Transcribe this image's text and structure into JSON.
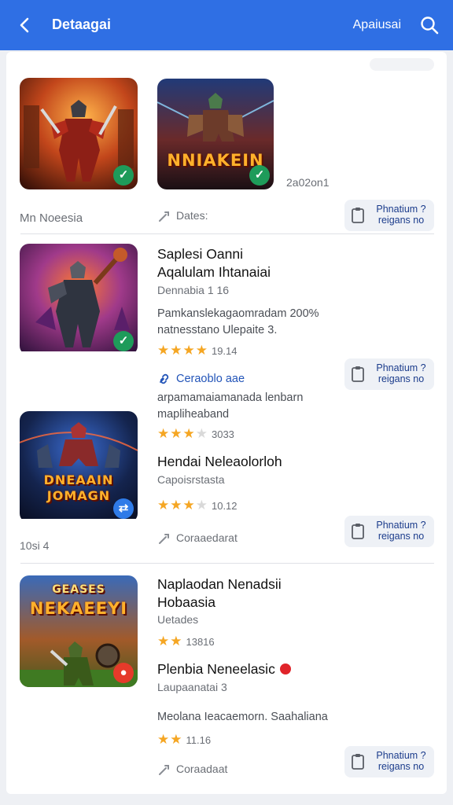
{
  "header": {
    "title": "Detaagai",
    "action": "Apaiusai"
  },
  "top": {
    "thumb_a_text": "",
    "thumb_b_text": "NNIAKEIN",
    "date": "2a02on1",
    "left_label": "Mn Noeesia",
    "meta": "Dates:",
    "button": [
      "Phnatium ?",
      "reigans no"
    ]
  },
  "item1": {
    "title_lines": [
      "Saplesi Oanni",
      "Aqalulam Ihtanaiai"
    ],
    "subtitle": "Dennabia 1 16",
    "desc_lines": [
      "Pamkanslekagaomradam 200%",
      "natnesstano Ulepaite 3."
    ],
    "rating": 4,
    "rating_text": "19.14",
    "link": "Ceraoblo aae",
    "desc2_lines": [
      "arpamamaiamanada lenbarn",
      "mapliheaband"
    ],
    "rating2": 3,
    "rating2_text": "3033",
    "button": [
      "Phnatium ?",
      "reigans no"
    ]
  },
  "item2": {
    "thumb_text": "DNEAAIN JOMAGN",
    "title": "Hendai Neleaolorloh",
    "subtitle": "Capoisrstasta",
    "rating": 3,
    "rating_text": "10.12",
    "meta": "Coraaedarat",
    "left_label": "10si 4",
    "button": [
      "Phnatium ?",
      "reigans no"
    ]
  },
  "item3": {
    "thumb_text_top": "GEASES",
    "thumb_text": "NEKAEEYI",
    "title_lines": [
      "Naplaodan Nenadsii",
      "Hobaasia"
    ],
    "subtitle": "Uetades",
    "rating": 2,
    "rating_text": "13816",
    "title2": "Plenbia Neneelasic",
    "subtitle2": "Laupaanatai 3",
    "desc": "Meolana Ieacaemorn. Saahaliana",
    "rating2": 2,
    "rating2_text": "11.16",
    "meta": "Coraadaat",
    "button": [
      "Phnatium ?",
      "reigans no"
    ]
  },
  "colors": {
    "appbar": "#2f6fe4",
    "star": "#f5a623",
    "link": "#2254b8"
  }
}
